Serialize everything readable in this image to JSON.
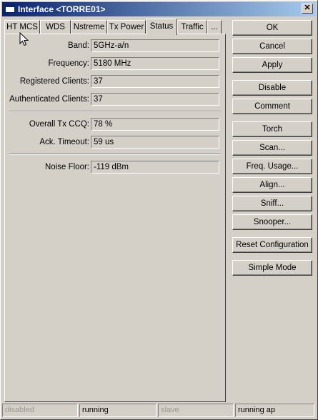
{
  "window": {
    "title": "Interface <TORRE01>",
    "close_glyph": "✕"
  },
  "tabs": [
    {
      "label": "HT MCS",
      "active": false
    },
    {
      "label": "WDS",
      "active": false
    },
    {
      "label": "Nstreme",
      "active": false
    },
    {
      "label": "Tx Power",
      "active": false
    },
    {
      "label": "Status",
      "active": true
    },
    {
      "label": "Traffic",
      "active": false
    },
    {
      "label": "...",
      "active": false
    }
  ],
  "status": {
    "band": {
      "label": "Band:",
      "value": "5GHz-a/n"
    },
    "frequency": {
      "label": "Frequency:",
      "value": "5180 MHz"
    },
    "registered_clients": {
      "label": "Registered Clients:",
      "value": "37"
    },
    "authenticated_clients": {
      "label": "Authenticated Clients:",
      "value": "37"
    },
    "overall_tx_ccq": {
      "label": "Overall Tx CCQ:",
      "value": "78 %"
    },
    "ack_timeout": {
      "label": "Ack. Timeout:",
      "value": "59 us"
    },
    "noise_floor": {
      "label": "Noise Floor:",
      "value": "-119 dBm"
    }
  },
  "buttons": {
    "ok": "OK",
    "cancel": "Cancel",
    "apply": "Apply",
    "disable": "Disable",
    "comment": "Comment",
    "torch": "Torch",
    "scan": "Scan...",
    "freq_usage": "Freq. Usage...",
    "align": "Align...",
    "sniff": "Sniff...",
    "snooper": "Snooper...",
    "reset_configuration": "Reset Configuration",
    "simple_mode": "Simple Mode"
  },
  "statusbar": {
    "seg1": "disabled",
    "seg2": "running",
    "seg3": "slave",
    "seg4": "running ap"
  },
  "icons": {
    "window": "window-icon",
    "close": "close-icon",
    "cursor": "mouse-pointer-icon"
  },
  "colors": {
    "title_start": "#0a246a",
    "title_end": "#a6caf0",
    "face": "#d4d0c8"
  }
}
